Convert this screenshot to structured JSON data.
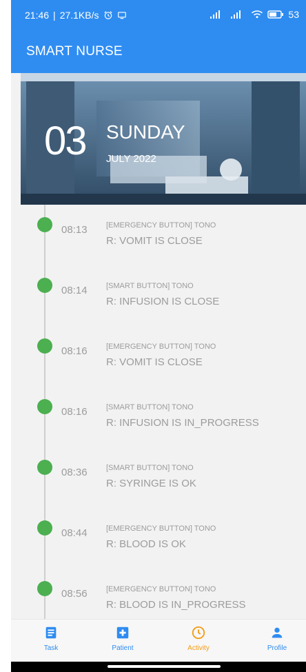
{
  "status": {
    "time": "21:46",
    "speed": "27.1KB/s",
    "battery": "53"
  },
  "app": {
    "title": "SMART NURSE"
  },
  "header": {
    "day": "03",
    "weekday": "SUNDAY",
    "month_year": "JULY 2022"
  },
  "events": [
    {
      "time": "08:13",
      "source": "[EMERGENCY BUTTON] TONO",
      "result": "R: VOMIT IS CLOSE"
    },
    {
      "time": "08:14",
      "source": "[SMART BUTTON] TONO",
      "result": "R: INFUSION IS CLOSE"
    },
    {
      "time": "08:16",
      "source": "[EMERGENCY BUTTON] TONO",
      "result": "R: VOMIT IS CLOSE"
    },
    {
      "time": "08:16",
      "source": "[SMART BUTTON] TONO",
      "result": "R: INFUSION IS IN_PROGRESS"
    },
    {
      "time": "08:36",
      "source": "[SMART BUTTON] TONO",
      "result": "R: SYRINGE IS OK"
    },
    {
      "time": "08:44",
      "source": "[EMERGENCY BUTTON] TONO",
      "result": "R: BLOOD IS OK"
    },
    {
      "time": "08:56",
      "source": "[EMERGENCY BUTTON] TONO",
      "result": "R: BLOOD IS IN_PROGRESS"
    }
  ],
  "nav": [
    {
      "label": "Task"
    },
    {
      "label": "Patient"
    },
    {
      "label": "Activity"
    },
    {
      "label": "Profile"
    }
  ],
  "colors": {
    "primary": "#2f8df2",
    "accent": "#f39c12",
    "dot": "#4caf50"
  }
}
